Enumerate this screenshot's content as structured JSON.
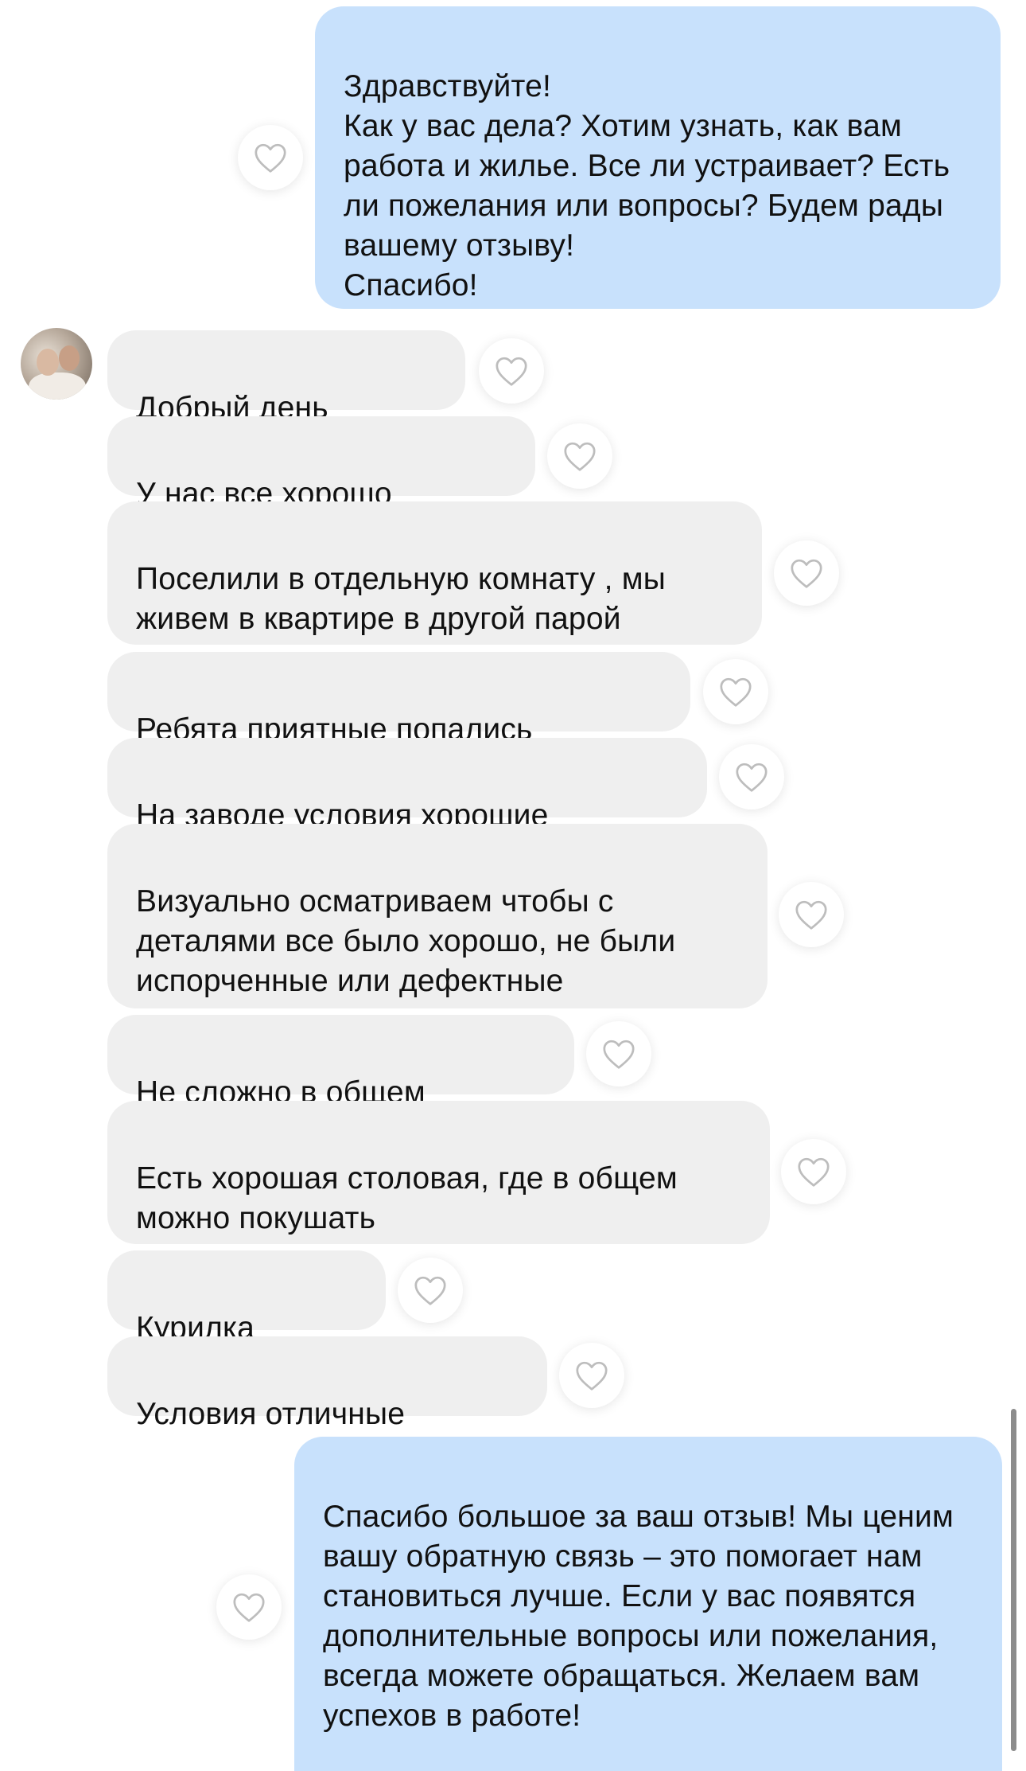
{
  "messages": [
    {
      "direction": "out",
      "text": "Здравствуйте!\nКак у вас дела? Хотим узнать, как вам работа и жилье. Все ли устраивает? Есть ли пожелания или вопросы? Будем рады вашему отзыву!\nСпасибо!"
    },
    {
      "direction": "in",
      "text": "Добрый день"
    },
    {
      "direction": "in",
      "text": "У нас все хорошо"
    },
    {
      "direction": "in",
      "text": "Поселили в отдельную комнату , мы живем в квартире в другой парой"
    },
    {
      "direction": "in",
      "text": "Ребята приятные попались"
    },
    {
      "direction": "in",
      "text": "На заводе условия хорошие"
    },
    {
      "direction": "in",
      "text": "Визуально осматриваем чтобы с деталями все было хорошо, не были испорченные или дефектные"
    },
    {
      "direction": "in",
      "text": "Не сложно в общем"
    },
    {
      "direction": "in",
      "text": "Есть хорошая столовая, где в общем можно покушать"
    },
    {
      "direction": "in",
      "text": "Курилка"
    },
    {
      "direction": "in",
      "text": "Условия отличные"
    },
    {
      "direction": "out",
      "text": "Спасибо большое за ваш отзыв! Мы ценим вашу обратную связь – это помогает нам становиться лучше. Если у вас появятся дополнительные вопросы или пожелания, всегда можете обращаться. Желаем вам успехов в работе!"
    }
  ],
  "icons": {
    "like": "heart-outline-icon",
    "sender": "avatar"
  },
  "colors": {
    "outgoing_bubble": "#c8e1fc",
    "incoming_bubble": "#efefef",
    "background": "#ffffff"
  }
}
